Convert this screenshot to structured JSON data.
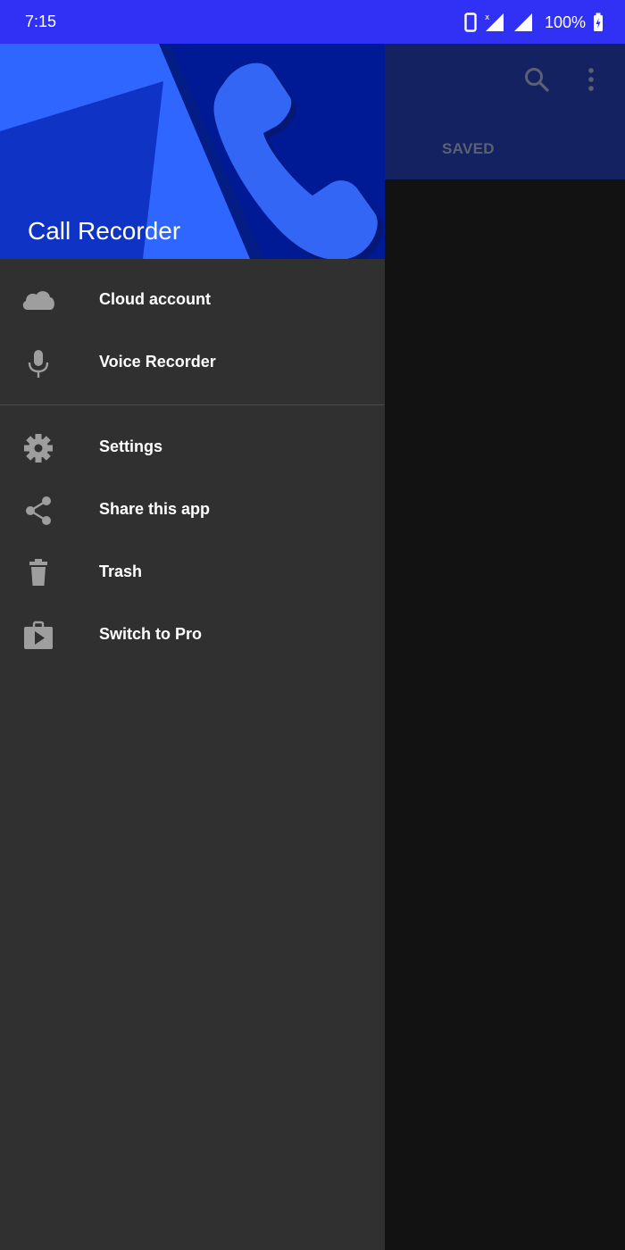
{
  "status_bar": {
    "time": "7:15",
    "battery": "100%"
  },
  "app_bar": {
    "tab_label": "SAVED",
    "search_icon": "search-icon",
    "more_icon": "more-vert-icon"
  },
  "drawer": {
    "title": "Call Recorder",
    "items": [
      {
        "label": "Cloud account",
        "icon": "cloud-icon"
      },
      {
        "label": "Voice Recorder",
        "icon": "microphone-icon"
      },
      {
        "label": "Settings",
        "icon": "gear-icon"
      },
      {
        "label": "Share this app",
        "icon": "share-icon"
      },
      {
        "label": "Trash",
        "icon": "trash-icon"
      },
      {
        "label": "Switch to Pro",
        "icon": "play-store-icon"
      }
    ]
  },
  "colors": {
    "status_bar": "#3131f5",
    "header_dark_blue": "#001a96",
    "header_light_blue": "#3366ff",
    "drawer_bg": "#303030",
    "appbar_bg": "#142262"
  }
}
